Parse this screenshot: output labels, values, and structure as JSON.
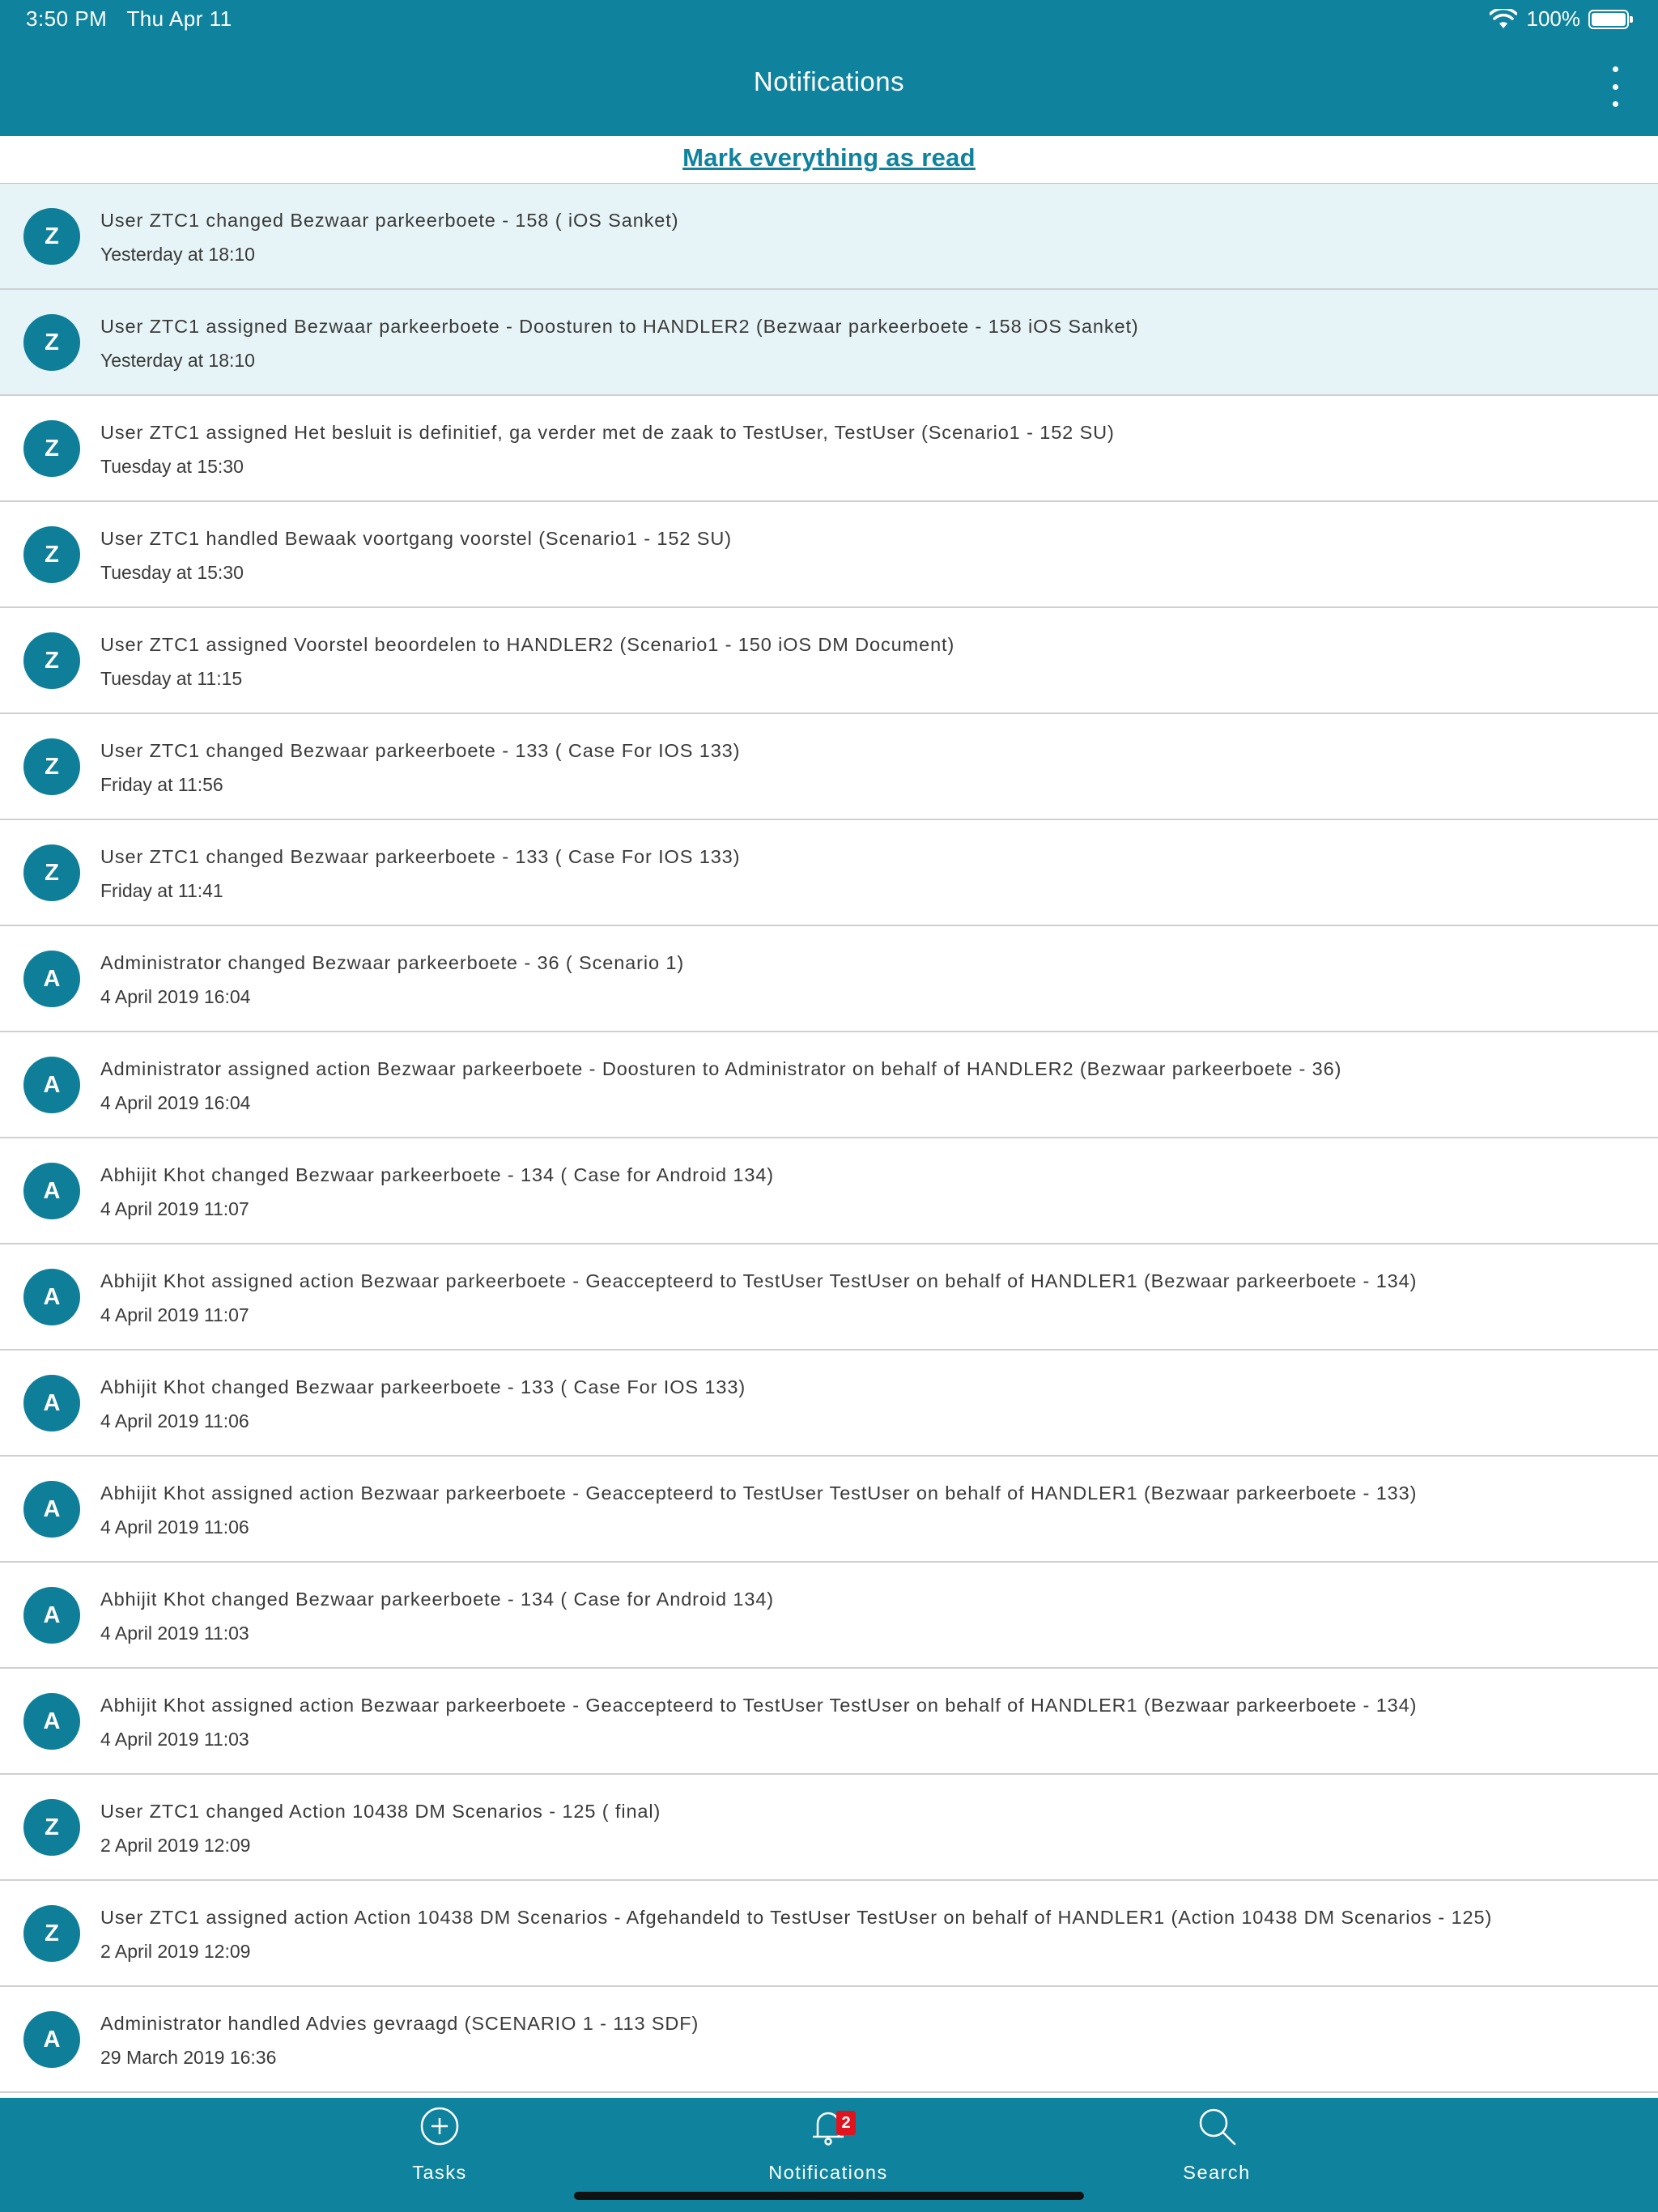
{
  "status_bar": {
    "time": "3:50 PM",
    "date": "Thu Apr 11",
    "battery": "100%"
  },
  "header": {
    "title": "Notifications"
  },
  "mark_all_label": "Mark everything as read",
  "colors": {
    "primary": "#0f829d",
    "unread_bg": "#e6f4f7",
    "badge": "#e0141e"
  },
  "notifications": [
    {
      "avatar": "Z",
      "text": "User ZTC1 changed Bezwaar parkeerboete - 158 ( iOS Sanket)",
      "time": "Yesterday at 18:10",
      "unread": true
    },
    {
      "avatar": "Z",
      "text": "User ZTC1 assigned Bezwaar parkeerboete - Doosturen to HANDLER2 (Bezwaar parkeerboete - 158 iOS Sanket)",
      "time": "Yesterday at 18:10",
      "unread": true
    },
    {
      "avatar": "Z",
      "text": "User ZTC1 assigned Het besluit is definitief, ga verder met de zaak to TestUser, TestUser (Scenario1 - 152 SU)",
      "time": "Tuesday at 15:30",
      "unread": false
    },
    {
      "avatar": "Z",
      "text": "User ZTC1 handled Bewaak voortgang voorstel (Scenario1 - 152 SU)",
      "time": "Tuesday at 15:30",
      "unread": false
    },
    {
      "avatar": "Z",
      "text": "User ZTC1 assigned Voorstel beoordelen to HANDLER2 (Scenario1 - 150 iOS DM Document)",
      "time": "Tuesday at 11:15",
      "unread": false
    },
    {
      "avatar": "Z",
      "text": "User ZTC1 changed Bezwaar parkeerboete - 133 ( Case For IOS 133)",
      "time": "Friday at 11:56",
      "unread": false
    },
    {
      "avatar": "Z",
      "text": "User ZTC1 changed Bezwaar parkeerboete - 133 ( Case For IOS 133)",
      "time": "Friday at 11:41",
      "unread": false
    },
    {
      "avatar": "A",
      "text": "Administrator changed Bezwaar parkeerboete - 36 ( Scenario 1)",
      "time": "4 April 2019 16:04",
      "unread": false
    },
    {
      "avatar": "A",
      "text": "Administrator assigned action Bezwaar parkeerboete - Doosturen to Administrator on behalf of HANDLER2 (Bezwaar parkeerboete - 36)",
      "time": "4 April 2019 16:04",
      "unread": false
    },
    {
      "avatar": "A",
      "text": "Abhijit Khot changed Bezwaar parkeerboete - 134 ( Case for Android 134)",
      "time": "4 April 2019 11:07",
      "unread": false
    },
    {
      "avatar": "A",
      "text": "Abhijit Khot assigned action Bezwaar parkeerboete - Geaccepteerd to TestUser TestUser on behalf of HANDLER1 (Bezwaar parkeerboete - 134)",
      "time": "4 April 2019 11:07",
      "unread": false
    },
    {
      "avatar": "A",
      "text": "Abhijit Khot changed Bezwaar parkeerboete - 133 ( Case For IOS 133)",
      "time": "4 April 2019 11:06",
      "unread": false
    },
    {
      "avatar": "A",
      "text": "Abhijit Khot assigned action Bezwaar parkeerboete - Geaccepteerd to TestUser TestUser on behalf of HANDLER1 (Bezwaar parkeerboete - 133)",
      "time": "4 April 2019 11:06",
      "unread": false
    },
    {
      "avatar": "A",
      "text": "Abhijit Khot changed Bezwaar parkeerboete - 134 ( Case for Android 134)",
      "time": "4 April 2019 11:03",
      "unread": false
    },
    {
      "avatar": "A",
      "text": "Abhijit Khot assigned action Bezwaar parkeerboete - Geaccepteerd to TestUser TestUser on behalf of HANDLER1 (Bezwaar parkeerboete - 134)",
      "time": "4 April 2019 11:03",
      "unread": false
    },
    {
      "avatar": "Z",
      "text": "User ZTC1 changed Action 10438 DM Scenarios - 125 ( final)",
      "time": "2 April 2019 12:09",
      "unread": false
    },
    {
      "avatar": "Z",
      "text": "User ZTC1 assigned action Action 10438 DM Scenarios - Afgehandeld to TestUser TestUser on behalf of HANDLER1 (Action 10438 DM Scenarios - 125)",
      "time": "2 April 2019 12:09",
      "unread": false
    },
    {
      "avatar": "A",
      "text": "Administrator handled Advies gevraagd (SCENARIO 1 - 113 SDF)",
      "time": "29 March 2019 16:36",
      "unread": false
    }
  ],
  "tabbar": {
    "tasks": {
      "label": "Tasks",
      "icon": "plus-circle-icon"
    },
    "notifications": {
      "label": "Notifications",
      "icon": "bell-icon",
      "badge": "2"
    },
    "search": {
      "label": "Search",
      "icon": "search-icon"
    }
  }
}
